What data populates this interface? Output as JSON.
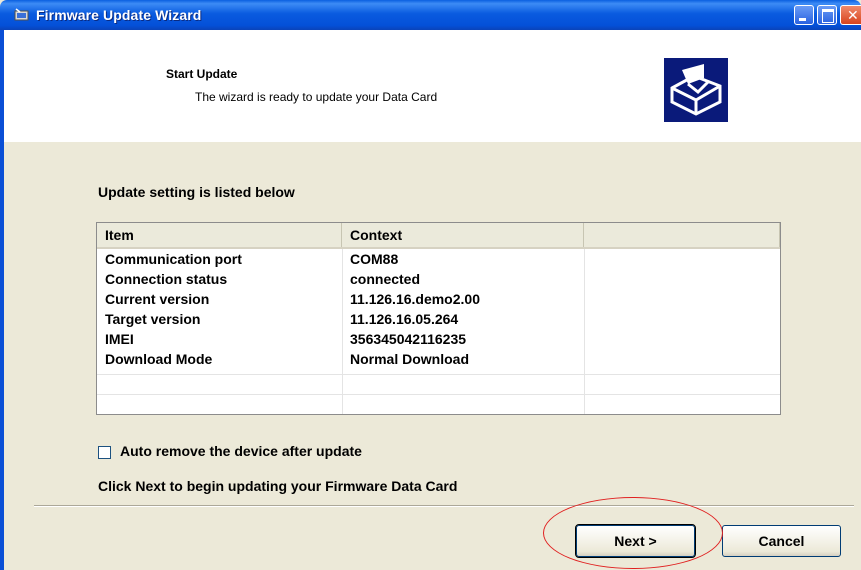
{
  "window": {
    "title": "Firmware Update Wizard"
  },
  "header": {
    "title": "Start Update",
    "subtitle": "The wizard is ready to update your Data Card"
  },
  "section": {
    "label": "Update setting is listed below"
  },
  "table": {
    "columns": [
      "Item",
      "Context",
      ""
    ],
    "rows": [
      [
        "Communication port",
        "COM88",
        ""
      ],
      [
        "Connection status",
        "connected",
        ""
      ],
      [
        "Current version",
        "11.126.16.demo2.00",
        ""
      ],
      [
        "Target version",
        "11.126.16.05.264",
        ""
      ],
      [
        "IMEI",
        "356345042116235",
        ""
      ],
      [
        "Download Mode",
        "Normal Download",
        ""
      ]
    ]
  },
  "options": {
    "auto_remove_label": "Auto remove the device after update",
    "auto_remove_checked": false
  },
  "hint": "Click Next to begin updating your Firmware Data Card",
  "buttons": {
    "next": "Next >",
    "cancel": "Cancel"
  },
  "colors": {
    "titlebar": "#0a5be0",
    "dialog_bg": "#ece9d8",
    "annotation": "#e02020",
    "header_logo_bg": "#0a1a7a"
  },
  "icons": {
    "app_icon": "wizard-app-icon",
    "header_logo": "data-card-install-icon"
  }
}
